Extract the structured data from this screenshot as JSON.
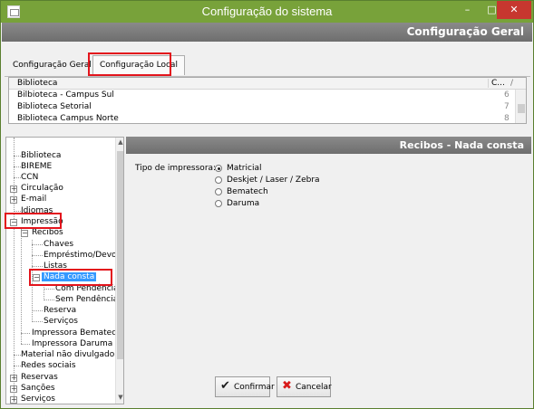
{
  "window": {
    "title": "Configuração do sistema"
  },
  "window_controls": {
    "minimize": "–",
    "maximize": "□",
    "close": "✕"
  },
  "header": {
    "title": "Configuração Geral"
  },
  "tabs": [
    {
      "label": "Configuração Geral"
    },
    {
      "label": "Configuração Local"
    }
  ],
  "table": {
    "columns": {
      "name": "Biblioteca",
      "code": "C...",
      "sort": "/"
    },
    "rows": [
      {
        "name": "Bilbioteca - Campus Sul",
        "code": "6"
      },
      {
        "name": "Biblioteca Setorial",
        "code": "7"
      },
      {
        "name": "Biblioteca Campus Norte",
        "code": "8"
      }
    ]
  },
  "tree": [
    {
      "label": "Biblioteca",
      "expander": ""
    },
    {
      "label": "BIREME",
      "expander": ""
    },
    {
      "label": "CCN",
      "expander": ""
    },
    {
      "label": "Circulação",
      "expander": "+"
    },
    {
      "label": "E-mail",
      "expander": "+"
    },
    {
      "label": "Idiomas",
      "expander": ""
    },
    {
      "label": "Impressão",
      "expander": "−"
    },
    {
      "label": "Recibos",
      "expander": "−"
    },
    {
      "label": "Chaves",
      "expander": ""
    },
    {
      "label": "Empréstimo/Devolução",
      "expander": ""
    },
    {
      "label": "Listas",
      "expander": ""
    },
    {
      "label": "Nada consta",
      "expander": "−"
    },
    {
      "label": "Com Pendência",
      "expander": ""
    },
    {
      "label": "Sem Pendência",
      "expander": ""
    },
    {
      "label": "Reserva",
      "expander": ""
    },
    {
      "label": "Serviços",
      "expander": ""
    },
    {
      "label": "Impressora Bematech",
      "expander": ""
    },
    {
      "label": "Impressora Daruma",
      "expander": ""
    },
    {
      "label": "Material não divulgado",
      "expander": ""
    },
    {
      "label": "Redes sociais",
      "expander": ""
    },
    {
      "label": "Reservas",
      "expander": "+"
    },
    {
      "label": "Sanções",
      "expander": "+"
    },
    {
      "label": "Serviços",
      "expander": "+"
    }
  ],
  "panel": {
    "title": "Recibos - Nada consta",
    "printer_label": "Tipo de impressora:",
    "options": [
      {
        "label": "Matricial",
        "selected": true
      },
      {
        "label": "Deskjet / Laser / Zebra",
        "selected": false
      },
      {
        "label": "Bematech",
        "selected": false
      },
      {
        "label": "Daruma",
        "selected": false
      }
    ]
  },
  "buttons": {
    "confirm": "Confirmar",
    "confirm_icon": "✔",
    "cancel": "Cancelar",
    "cancel_icon": "✖"
  },
  "colors": {
    "titlebar": "#78a23a",
    "close": "#c7372f",
    "highlight": "#e3141c",
    "selection": "#3399ff",
    "confirm_icon": "#1d1d1d",
    "cancel_icon": "#d81a1a"
  }
}
